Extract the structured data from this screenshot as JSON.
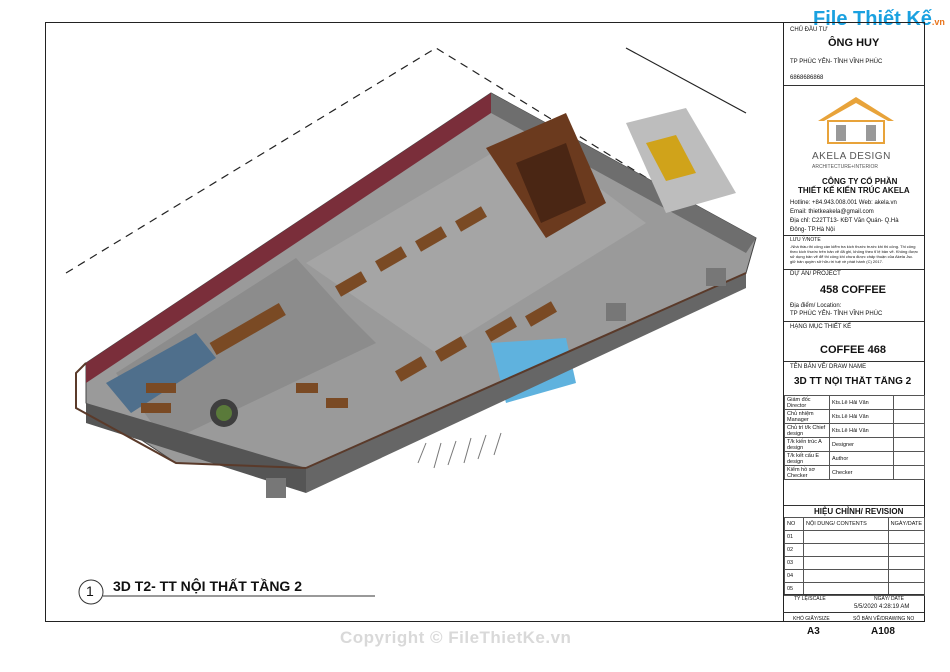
{
  "title_block": {
    "owner_label": "CHỦ ĐẦU TƯ",
    "owner_name": "ÔNG HUY",
    "owner_location": "TP PHÚC YÊN- TỈNH VĨNH PHÚC",
    "owner_phone": "6868686868",
    "logo_name": "AKELA DESIGN",
    "logo_tagline": "ARCHITECTURE+INTERIOR",
    "company_line1": "CÔNG TY CỔ PHẦN",
    "company_line2": "THIẾT KẾ KIẾN TRÚC AKELA",
    "hotline": "Hotline: +84.943.008.001   Web: akela.vn",
    "email": "Email: thietkeakela@gmail.com",
    "address1": "Địa chỉ: C22TT13- KĐT Văn Quán- Q.Hà",
    "address2": "Đông- TP.Hà Nội",
    "note_label": "LƯU Ý/NOTE",
    "note_text": "-Nhà thầu thi công cần kiểm tra kích thước trước khi thi công. Thi công theo kích thước trên bản vẽ đã ghi, không theo tỉ lệ bản vẽ. Không được sử dụng bản vẽ để thi công khi chưa được chấp thuận của Akela Jsc. giữ bản quyền sở hữu trí tuệ về phát hành (C) 2017.",
    "project_label": "DỰ ÁN/ PROJECT",
    "project_name": "458 COFFEE",
    "location_label": "Địa điểm/ Location:",
    "location_value": "TP PHÚC YÊN- TỈNH VĨNH PHÚC",
    "category_label": "HẠNG MỤC THIẾT KẾ",
    "category_value": "COFFEE 468",
    "drawing_name_label": "TÊN BẢN VẼ/ DRAW NAME",
    "drawing_name_value": "3D TT NỘI THẤT TẦNG 2",
    "staff": [
      {
        "role": "Giám đốc Director",
        "name": "Kts.Lê Hải Văn"
      },
      {
        "role": "Chủ nhiệm Manager",
        "name": "Kts.Lê Hải Văn"
      },
      {
        "role": "Chủ trì t/k Chief design",
        "name": "Kts.Lê Hải Văn"
      },
      {
        "role": "T/k kiến trúc A design",
        "name": "Designer"
      },
      {
        "role": "T/k kết cấu E design",
        "name": "Author"
      },
      {
        "role": "Kiểm hồ sơ Checker",
        "name": "Checker"
      }
    ],
    "revision_label": "HIỆU CHỈNH/ REVISION",
    "rev_headers": [
      "NO",
      "NỘI DUNG/ CONTENTS",
      "NGÀY/DATE"
    ],
    "rev_rows": [
      "01",
      "02",
      "03",
      "04",
      "05"
    ],
    "scale_label": "TỶ LỆ/SCALE",
    "date_label": "NGÀY/ DATE",
    "date_value": "5/5/2020 4:28:19 AM",
    "size_label": "KHỔ GIẤY/SIZE",
    "size_value": "A3",
    "drawing_no_label": "SỐ BẢN VẼ/DRAWING NO",
    "drawing_no_value": "A108"
  },
  "view_label": {
    "number": "1",
    "text": "3D T2- TT NỘI THẤT TẦNG 2"
  },
  "watermark": {
    "logo_main": "File Thiết Kế",
    "logo_suffix": ".vn",
    "copyright": "Copyright © FileThietKe.vn"
  }
}
